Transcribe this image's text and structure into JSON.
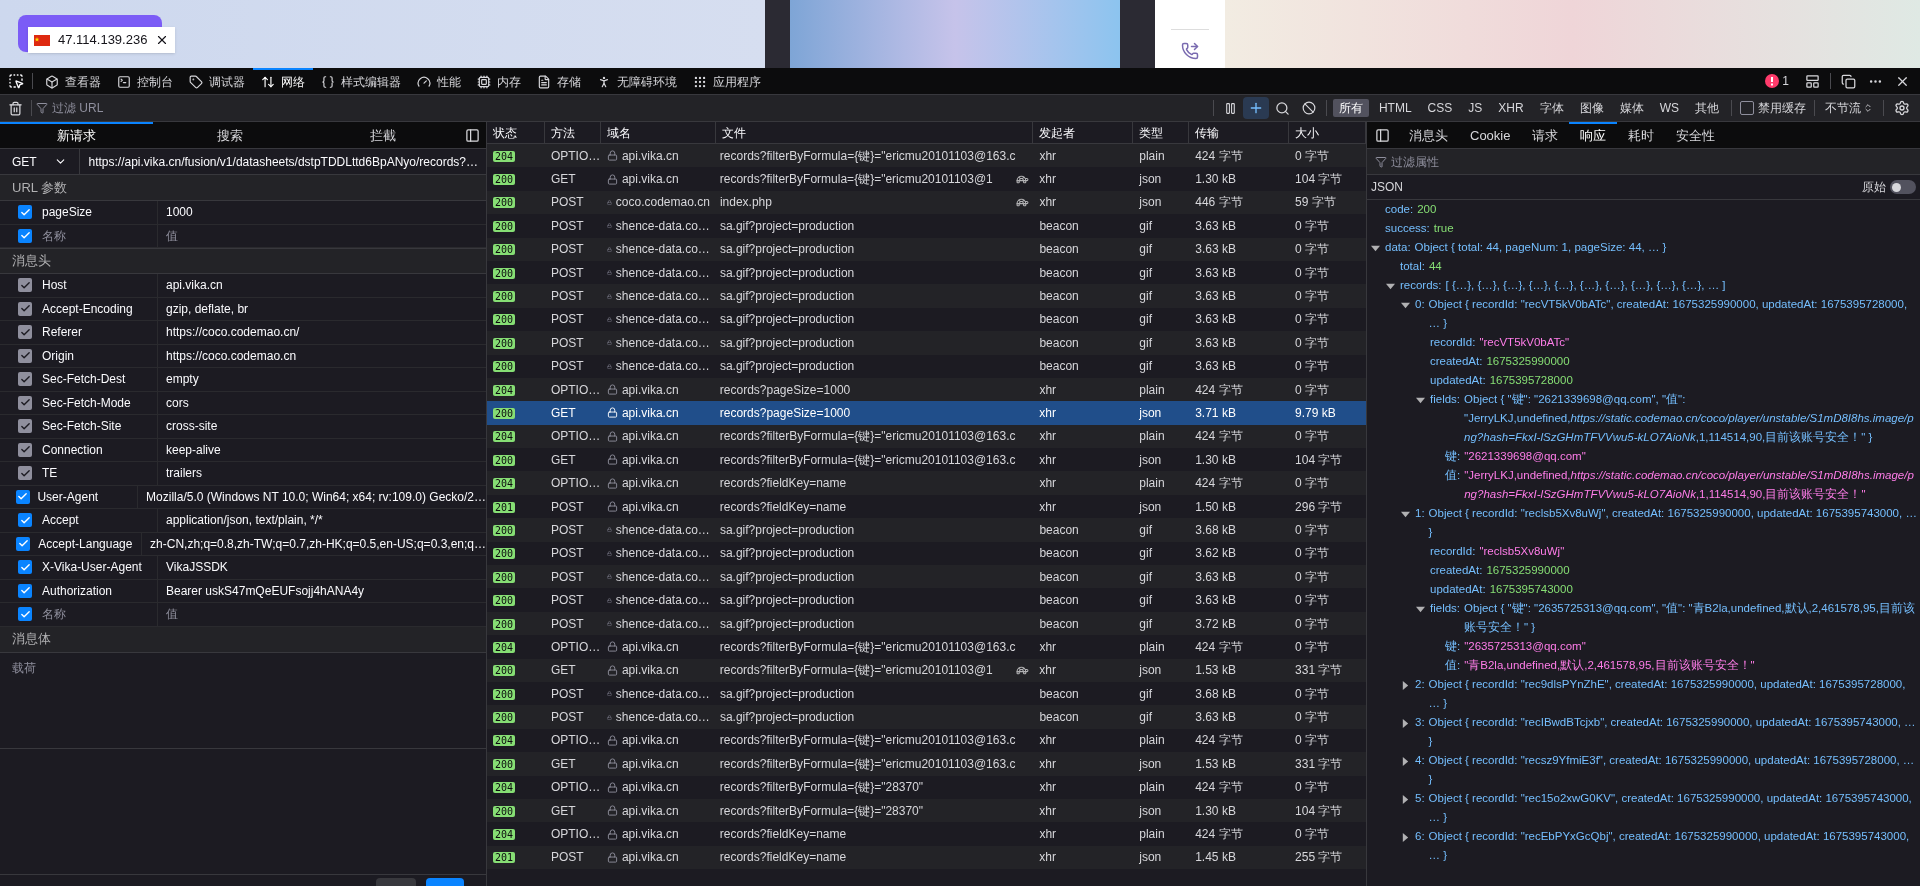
{
  "page": {
    "address_tag": {
      "ip": "47.114.139.236"
    }
  },
  "toolbar": {
    "tabs": [
      {
        "label": "查看器",
        "selected": false
      },
      {
        "label": "控制台",
        "selected": false
      },
      {
        "label": "调试器",
        "selected": false
      },
      {
        "label": "网络",
        "selected": true
      },
      {
        "label": "样式编辑器",
        "selected": false
      },
      {
        "label": "性能",
        "selected": false
      },
      {
        "label": "内存",
        "selected": false
      },
      {
        "label": "存储",
        "selected": false
      },
      {
        "label": "无障碍环境",
        "selected": false
      },
      {
        "label": "应用程序",
        "selected": false
      }
    ],
    "error_count": "1"
  },
  "filter_bar": {
    "placeholder": "过滤 URL",
    "new_request_active": true,
    "types": [
      {
        "label": "所有",
        "selected": true
      },
      {
        "label": "HTML",
        "selected": false
      },
      {
        "label": "CSS",
        "selected": false
      },
      {
        "label": "JS",
        "selected": false
      },
      {
        "label": "XHR",
        "selected": false
      },
      {
        "label": "字体",
        "selected": false
      },
      {
        "label": "图像",
        "selected": false
      },
      {
        "label": "媒体",
        "selected": false
      },
      {
        "label": "WS",
        "selected": false
      },
      {
        "label": "其他",
        "selected": false
      }
    ],
    "disable_cache": {
      "label": "禁用缓存",
      "checked": false
    },
    "throttle": "不节流"
  },
  "request": {
    "tabs": [
      {
        "label": "新请求",
        "selected": true
      },
      {
        "label": "搜索",
        "selected": false
      },
      {
        "label": "拦截",
        "selected": false
      }
    ],
    "method": "GET",
    "url": "https://api.vika.cn/fusion/v1/datasheets/dstpTDDLttd6BpANyo/records?…",
    "url_params": {
      "title": "URL 参数",
      "rows": [
        {
          "name": "pageSize",
          "value": "1000",
          "checked": true,
          "disabled": false,
          "kind": "entry"
        },
        {
          "name": "名称",
          "value": "值",
          "checked": true,
          "disabled": false,
          "kind": "blank"
        }
      ]
    },
    "headers": {
      "title": "消息头",
      "rows": [
        {
          "name": "Host",
          "value": "api.vika.cn",
          "checked": true,
          "disabled": true,
          "kind": "entry"
        },
        {
          "name": "Accept-Encoding",
          "value": "gzip, deflate, br",
          "checked": true,
          "disabled": true,
          "kind": "entry"
        },
        {
          "name": "Referer",
          "value": "https://coco.codemao.cn/",
          "checked": true,
          "disabled": true,
          "kind": "entry"
        },
        {
          "name": "Origin",
          "value": "https://coco.codemao.cn",
          "checked": true,
          "disabled": true,
          "kind": "entry"
        },
        {
          "name": "Sec-Fetch-Dest",
          "value": "empty",
          "checked": true,
          "disabled": true,
          "kind": "entry"
        },
        {
          "name": "Sec-Fetch-Mode",
          "value": "cors",
          "checked": true,
          "disabled": true,
          "kind": "entry"
        },
        {
          "name": "Sec-Fetch-Site",
          "value": "cross-site",
          "checked": true,
          "disabled": true,
          "kind": "entry"
        },
        {
          "name": "Connection",
          "value": "keep-alive",
          "checked": true,
          "disabled": true,
          "kind": "entry"
        },
        {
          "name": "TE",
          "value": "trailers",
          "checked": true,
          "disabled": true,
          "kind": "entry"
        },
        {
          "name": "User-Agent",
          "value": "Mozilla/5.0 (Windows NT 10.0; Win64; x64; rv:109.0) Gecko/2…",
          "checked": true,
          "disabled": false,
          "kind": "entry"
        },
        {
          "name": "Accept",
          "value": "application/json, text/plain, */*",
          "checked": true,
          "disabled": false,
          "kind": "entry"
        },
        {
          "name": "Accept-Language",
          "value": "zh-CN,zh;q=0.8,zh-TW;q=0.7,zh-HK;q=0.5,en-US;q=0.3,en;q…",
          "checked": true,
          "disabled": false,
          "kind": "entry"
        },
        {
          "name": "X-Vika-User-Agent",
          "value": "VikaJSSDK",
          "checked": true,
          "disabled": false,
          "kind": "entry"
        },
        {
          "name": "Authorization",
          "value": "Bearer uskS47mQeEUFsojj4hANA4y",
          "checked": true,
          "disabled": false,
          "kind": "entry"
        },
        {
          "name": "名称",
          "value": "值",
          "checked": true,
          "disabled": false,
          "kind": "blank"
        }
      ]
    },
    "body": {
      "title": "消息体",
      "placeholder": "载荷"
    }
  },
  "table": {
    "columns": [
      "状态",
      "方法",
      "域名",
      "文件",
      "发起者",
      "类型",
      "传输",
      "大小"
    ],
    "rows": [
      {
        "status": "204",
        "method": "OPTIO…",
        "domain": "api.vika.cn",
        "file": "records?filterByFormula={键}=\"ericmu20101103@163.c",
        "initiator": "xhr",
        "type": "plain",
        "transferred": "424 字节",
        "size": "0 字节",
        "slow": false,
        "selected": false
      },
      {
        "status": "200",
        "method": "GET",
        "domain": "api.vika.cn",
        "file": "records?filterByFormula={键}=\"ericmu20101103@1",
        "initiator": "xhr",
        "type": "json",
        "transferred": "1.30 kB",
        "size": "104 字节",
        "slow": true,
        "selected": false
      },
      {
        "status": "200",
        "method": "POST",
        "domain": "coco.codemao.cn",
        "file": "index.php",
        "initiator": "xhr",
        "type": "json",
        "transferred": "446 字节",
        "size": "59 字节",
        "slow": true,
        "selected": false
      },
      {
        "status": "200",
        "method": "POST",
        "domain": "shence-data.co…",
        "file": "sa.gif?project=production",
        "initiator": "beacon",
        "type": "gif",
        "transferred": "3.63 kB",
        "size": "0 字节",
        "slow": false,
        "selected": false
      },
      {
        "status": "200",
        "method": "POST",
        "domain": "shence-data.co…",
        "file": "sa.gif?project=production",
        "initiator": "beacon",
        "type": "gif",
        "transferred": "3.63 kB",
        "size": "0 字节",
        "slow": false,
        "selected": false
      },
      {
        "status": "200",
        "method": "POST",
        "domain": "shence-data.co…",
        "file": "sa.gif?project=production",
        "initiator": "beacon",
        "type": "gif",
        "transferred": "3.63 kB",
        "size": "0 字节",
        "slow": false,
        "selected": false
      },
      {
        "status": "200",
        "method": "POST",
        "domain": "shence-data.co…",
        "file": "sa.gif?project=production",
        "initiator": "beacon",
        "type": "gif",
        "transferred": "3.63 kB",
        "size": "0 字节",
        "slow": false,
        "selected": false
      },
      {
        "status": "200",
        "method": "POST",
        "domain": "shence-data.co…",
        "file": "sa.gif?project=production",
        "initiator": "beacon",
        "type": "gif",
        "transferred": "3.63 kB",
        "size": "0 字节",
        "slow": false,
        "selected": false
      },
      {
        "status": "200",
        "method": "POST",
        "domain": "shence-data.co…",
        "file": "sa.gif?project=production",
        "initiator": "beacon",
        "type": "gif",
        "transferred": "3.63 kB",
        "size": "0 字节",
        "slow": false,
        "selected": false
      },
      {
        "status": "200",
        "method": "POST",
        "domain": "shence-data.co…",
        "file": "sa.gif?project=production",
        "initiator": "beacon",
        "type": "gif",
        "transferred": "3.63 kB",
        "size": "0 字节",
        "slow": false,
        "selected": false
      },
      {
        "status": "204",
        "method": "OPTIO…",
        "domain": "api.vika.cn",
        "file": "records?pageSize=1000",
        "initiator": "xhr",
        "type": "plain",
        "transferred": "424 字节",
        "size": "0 字节",
        "slow": false,
        "selected": false
      },
      {
        "status": "200",
        "method": "GET",
        "domain": "api.vika.cn",
        "file": "records?pageSize=1000",
        "initiator": "xhr",
        "type": "json",
        "transferred": "3.71 kB",
        "size": "9.79 kB",
        "slow": false,
        "selected": true
      },
      {
        "status": "204",
        "method": "OPTIO…",
        "domain": "api.vika.cn",
        "file": "records?filterByFormula={键}=\"ericmu20101103@163.c",
        "initiator": "xhr",
        "type": "plain",
        "transferred": "424 字节",
        "size": "0 字节",
        "slow": false,
        "selected": false
      },
      {
        "status": "200",
        "method": "GET",
        "domain": "api.vika.cn",
        "file": "records?filterByFormula={键}=\"ericmu20101103@163.c",
        "initiator": "xhr",
        "type": "json",
        "transferred": "1.30 kB",
        "size": "104 字节",
        "slow": false,
        "selected": false
      },
      {
        "status": "204",
        "method": "OPTIO…",
        "domain": "api.vika.cn",
        "file": "records?fieldKey=name",
        "initiator": "xhr",
        "type": "plain",
        "transferred": "424 字节",
        "size": "0 字节",
        "slow": false,
        "selected": false
      },
      {
        "status": "201",
        "method": "POST",
        "domain": "api.vika.cn",
        "file": "records?fieldKey=name",
        "initiator": "xhr",
        "type": "json",
        "transferred": "1.50 kB",
        "size": "296 字节",
        "slow": false,
        "selected": false
      },
      {
        "status": "200",
        "method": "POST",
        "domain": "shence-data.co…",
        "file": "sa.gif?project=production",
        "initiator": "beacon",
        "type": "gif",
        "transferred": "3.68 kB",
        "size": "0 字节",
        "slow": false,
        "selected": false
      },
      {
        "status": "200",
        "method": "POST",
        "domain": "shence-data.co…",
        "file": "sa.gif?project=production",
        "initiator": "beacon",
        "type": "gif",
        "transferred": "3.62 kB",
        "size": "0 字节",
        "slow": false,
        "selected": false
      },
      {
        "status": "200",
        "method": "POST",
        "domain": "shence-data.co…",
        "file": "sa.gif?project=production",
        "initiator": "beacon",
        "type": "gif",
        "transferred": "3.63 kB",
        "size": "0 字节",
        "slow": false,
        "selected": false
      },
      {
        "status": "200",
        "method": "POST",
        "domain": "shence-data.co…",
        "file": "sa.gif?project=production",
        "initiator": "beacon",
        "type": "gif",
        "transferred": "3.63 kB",
        "size": "0 字节",
        "slow": false,
        "selected": false
      },
      {
        "status": "200",
        "method": "POST",
        "domain": "shence-data.co…",
        "file": "sa.gif?project=production",
        "initiator": "beacon",
        "type": "gif",
        "transferred": "3.72 kB",
        "size": "0 字节",
        "slow": false,
        "selected": false
      },
      {
        "status": "204",
        "method": "OPTIO…",
        "domain": "api.vika.cn",
        "file": "records?filterByFormula={键}=\"ericmu20101103@163.c",
        "initiator": "xhr",
        "type": "plain",
        "transferred": "424 字节",
        "size": "0 字节",
        "slow": false,
        "selected": false
      },
      {
        "status": "200",
        "method": "GET",
        "domain": "api.vika.cn",
        "file": "records?filterByFormula={键}=\"ericmu20101103@1",
        "initiator": "xhr",
        "type": "json",
        "transferred": "1.53 kB",
        "size": "331 字节",
        "slow": true,
        "selected": false
      },
      {
        "status": "200",
        "method": "POST",
        "domain": "shence-data.co…",
        "file": "sa.gif?project=production",
        "initiator": "beacon",
        "type": "gif",
        "transferred": "3.68 kB",
        "size": "0 字节",
        "slow": false,
        "selected": false
      },
      {
        "status": "200",
        "method": "POST",
        "domain": "shence-data.co…",
        "file": "sa.gif?project=production",
        "initiator": "beacon",
        "type": "gif",
        "transferred": "3.63 kB",
        "size": "0 字节",
        "slow": false,
        "selected": false
      },
      {
        "status": "204",
        "method": "OPTIO…",
        "domain": "api.vika.cn",
        "file": "records?filterByFormula={键}=\"ericmu20101103@163.c",
        "initiator": "xhr",
        "type": "plain",
        "transferred": "424 字节",
        "size": "0 字节",
        "slow": false,
        "selected": false
      },
      {
        "status": "200",
        "method": "GET",
        "domain": "api.vika.cn",
        "file": "records?filterByFormula={键}=\"ericmu20101103@163.c",
        "initiator": "xhr",
        "type": "json",
        "transferred": "1.53 kB",
        "size": "331 字节",
        "slow": false,
        "selected": false
      },
      {
        "status": "204",
        "method": "OPTIO…",
        "domain": "api.vika.cn",
        "file": "records?filterByFormula={键}=\"28370\"",
        "initiator": "xhr",
        "type": "plain",
        "transferred": "424 字节",
        "size": "0 字节",
        "slow": false,
        "selected": false
      },
      {
        "status": "200",
        "method": "GET",
        "domain": "api.vika.cn",
        "file": "records?filterByFormula={键}=\"28370\"",
        "initiator": "xhr",
        "type": "json",
        "transferred": "1.30 kB",
        "size": "104 字节",
        "slow": false,
        "selected": false
      },
      {
        "status": "204",
        "method": "OPTIO…",
        "domain": "api.vika.cn",
        "file": "records?fieldKey=name",
        "initiator": "xhr",
        "type": "plain",
        "transferred": "424 字节",
        "size": "0 字节",
        "slow": false,
        "selected": false
      },
      {
        "status": "201",
        "method": "POST",
        "domain": "api.vika.cn",
        "file": "records?fieldKey=name",
        "initiator": "xhr",
        "type": "json",
        "transferred": "1.45 kB",
        "size": "255 字节",
        "slow": false,
        "selected": false
      }
    ]
  },
  "details": {
    "tabs": [
      {
        "label": "消息头",
        "selected": false
      },
      {
        "label": "Cookie",
        "selected": false
      },
      {
        "label": "请求",
        "selected": false
      },
      {
        "label": "响应",
        "selected": true
      },
      {
        "label": "耗时",
        "selected": false
      },
      {
        "label": "安全性",
        "selected": false
      }
    ],
    "filter_placeholder": "过滤属性",
    "section": "JSON",
    "raw": {
      "label": "原始",
      "on": false
    },
    "tree": [
      {
        "key": "code:",
        "value": "200",
        "kind": "number"
      },
      {
        "key": "success:",
        "value": "true",
        "kind": "bool"
      },
      {
        "key": "data:",
        "value": "Object { total: 44, pageNum: 1, pageSize: 44, … }",
        "kind": "object",
        "expanded": true,
        "children": [
          {
            "key": "total:",
            "value": "44",
            "kind": "number"
          },
          {
            "key": "records:",
            "value": "[ {…}, {…}, {…}, {…}, {…}, {…}, {…}, {…}, {…}, {…}, … ]",
            "kind": "object",
            "expanded": true,
            "children": [
              {
                "key": "0:",
                "value": "Object { recordId: \"recVT5kV0bATc\", createdAt: 1675325990000, updatedAt: 1675395728000, … }",
                "kind": "object",
                "expanded": true,
                "children": [
                  {
                    "key": "recordId:",
                    "value": "\"recVT5kV0bATc\"",
                    "kind": "string"
                  },
                  {
                    "key": "createdAt:",
                    "value": "1675325990000",
                    "kind": "number"
                  },
                  {
                    "key": "updatedAt:",
                    "value": "1675395728000",
                    "kind": "number"
                  },
                  {
                    "key": "fields:",
                    "value": "Object { \"键\": \"2621339698@qq.com\", \"值\": \"JerryLKJ,undefined,*https://static.codemao.cn/coco/player/unstable/S1mD8I8hs.image/png?hash=FkxI-lSzGHmTFVVwu5-kLO7AioNk*,1,114514,90,目前该账号安全！\" }",
                    "kind": "object",
                    "expanded": true,
                    "children": [
                      {
                        "key": "键:",
                        "value": "\"2621339698@qq.com\"",
                        "kind": "string"
                      },
                      {
                        "key": "值:",
                        "value": "\"JerryLKJ,undefined,*https://static.codemao.cn/coco/player/unstable/S1mD8I8hs.image/png?hash=FkxI-lSzGHmTFVVwu5-kLO7AioNk*,1,114514,90,目前该账号安全！\"",
                        "kind": "string"
                      }
                    ]
                  }
                ]
              },
              {
                "key": "1:",
                "value": "Object { recordId: \"reclsb5Xv8uWj\", createdAt: 1675325990000, updatedAt: 1675395743000, … }",
                "kind": "object",
                "expanded": true,
                "children": [
                  {
                    "key": "recordId:",
                    "value": "\"reclsb5Xv8uWj\"",
                    "kind": "string"
                  },
                  {
                    "key": "createdAt:",
                    "value": "1675325990000",
                    "kind": "number"
                  },
                  {
                    "key": "updatedAt:",
                    "value": "1675395743000",
                    "kind": "number"
                  },
                  {
                    "key": "fields:",
                    "value": "Object { \"键\": \"2635725313@qq.com\", \"值\": \"青B2la,undefined,默认,2,461578,95,目前该账号安全！\" }",
                    "kind": "object",
                    "expanded": true,
                    "children": [
                      {
                        "key": "键:",
                        "value": "\"2635725313@qq.com\"",
                        "kind": "string"
                      },
                      {
                        "key": "值:",
                        "value": "\"青B2la,undefined,默认,2,461578,95,目前该账号安全！\"",
                        "kind": "string"
                      }
                    ]
                  }
                ]
              },
              {
                "key": "2:",
                "value": "Object { recordId: \"rec9dlsPYnZhE\", createdAt: 1675325990000, updatedAt: 1675395728000, … }",
                "kind": "object",
                "expanded": false
              },
              {
                "key": "3:",
                "value": "Object { recordId: \"recIBwdBTcjxb\", createdAt: 1675325990000, updatedAt: 1675395743000, … }",
                "kind": "object",
                "expanded": false
              },
              {
                "key": "4:",
                "value": "Object { recordId: \"recsz9YfmiE3f\", createdAt: 1675325990000, updatedAt: 1675395728000, … }",
                "kind": "object",
                "expanded": false
              },
              {
                "key": "5:",
                "value": "Object { recordId: \"rec15o2xwG0KV\", createdAt: 1675325990000, updatedAt: 1675395743000, … }",
                "kind": "object",
                "expanded": false
              },
              {
                "key": "6:",
                "value": "Object { recordId: \"recEbPYxGcQbj\", createdAt: 1675325990000, updatedAt: 1675395743000, … }",
                "kind": "object",
                "expanded": false
              }
            ]
          }
        ]
      }
    ]
  }
}
